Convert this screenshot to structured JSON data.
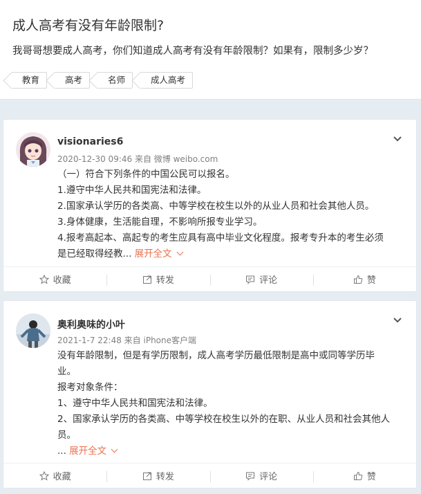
{
  "question": {
    "title": "成人高考有没有年龄限制?",
    "description": "我哥哥想要成人高考，你们知道成人高考有没有年龄限制？如果有，限制多少岁？",
    "tags": [
      "教育",
      "高考",
      "名师",
      "成人高考"
    ]
  },
  "answers": [
    {
      "username": "visionaries6",
      "meta": "2020-12-30 09:46 来自 微博 weibo.com",
      "lines": [
        "（一）符合下列条件的中国公民可以报名。",
        "1.遵守中华人民共和国宪法和法律。",
        "2.国家承认学历的各类高、中等学校在校生以外的从业人员和社会其他人员。",
        "3.身体健康，生活能自理，不影响所报专业学习。",
        "4.报考高起本、高起专的考生应具有高中毕业文化程度。报考专升本的考生必须",
        "是已经取得经教..."
      ],
      "expand_label": "展开全文"
    },
    {
      "username": "奥利奥味的小叶",
      "meta": "2021-1-7 22:48 来自 iPhone客户端",
      "lines": [
        "没有年龄限制，但是有学历限制，成人高考学历最低限制是高中或同等学历毕",
        "业。",
        "报考对象条件：",
        "1、遵守中华人民共和国宪法和法律。",
        "2、国家承认学历的各类高、中等学校在校生以外的在职、从业人员和社会其他人",
        "员。",
        "..."
      ],
      "expand_label": "展开全文"
    }
  ],
  "actions": {
    "favorite": "收藏",
    "repost": "转发",
    "comment": "评论",
    "like": "赞"
  },
  "colors": {
    "accent": "#eb7350",
    "page_bg": "#e6edf2"
  },
  "icons": [
    "star-icon",
    "repost-icon",
    "comment-icon",
    "like-icon",
    "chevron-down-icon"
  ]
}
